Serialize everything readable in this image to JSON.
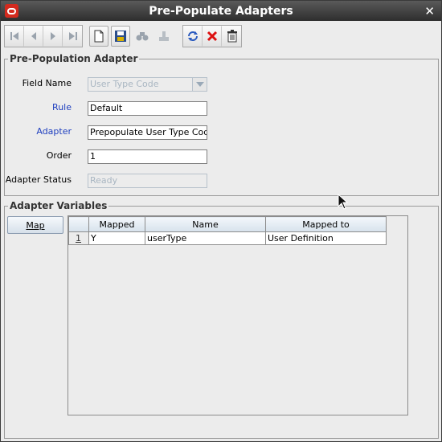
{
  "window": {
    "title": "Pre-Populate Adapters"
  },
  "toolbar": {
    "icons": [
      "first-record-icon",
      "previous-record-icon",
      "next-record-icon",
      "last-record-icon",
      "new-document-icon",
      "save-icon",
      "search-icon",
      "clear-icon",
      "refresh-icon",
      "delete-x-icon",
      "trash-icon"
    ]
  },
  "prepop": {
    "title": "Pre-Population Adapter",
    "field_name_label": "Field Name",
    "field_name_value": "User Type Code",
    "rule_label": "Rule",
    "rule_value": "Default",
    "adapter_label": "Adapter",
    "adapter_value": "Prepopulate User Type Cod",
    "order_label": "Order",
    "order_value": "1",
    "status_label": "Adapter Status",
    "status_value": "Ready"
  },
  "variables": {
    "title": "Adapter Variables",
    "map_label": "Map",
    "columns": [
      "Mapped",
      "Name",
      "Mapped to"
    ],
    "rows": [
      {
        "num": "1",
        "mapped": "Y",
        "name": "userType",
        "mapped_to": "User Definition"
      }
    ]
  },
  "colors": {
    "title_bar": "#3a3a3a",
    "accent_red": "#d32a1e",
    "label_blue": "#1f3fbf"
  }
}
